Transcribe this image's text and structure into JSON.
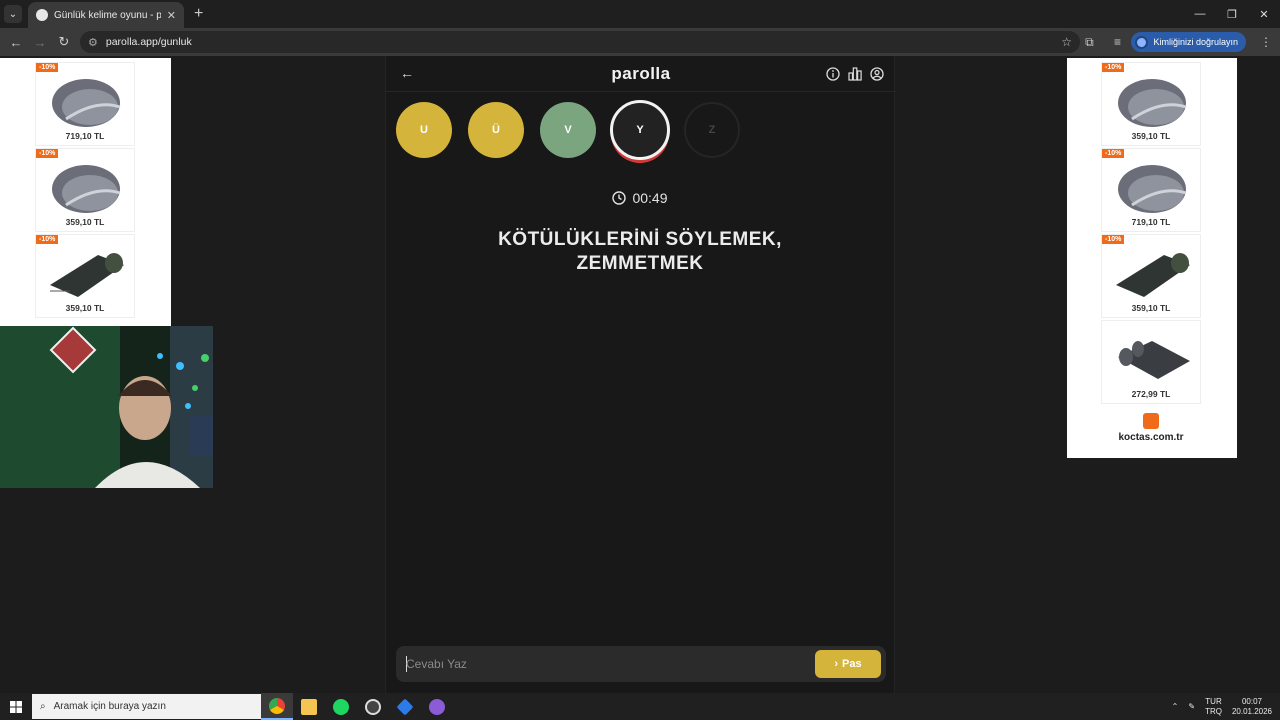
{
  "browser": {
    "tab_title": "Günlük kelime oyunu - parolla",
    "url": "parolla.app/gunluk",
    "profile_label": "Kimliğinizi doğrulayın"
  },
  "ads": {
    "left": [
      {
        "badge": "-10%",
        "price": "719,10 TL",
        "kind": "carpet"
      },
      {
        "badge": "-10%",
        "price": "359,10 TL",
        "kind": "carpet"
      },
      {
        "badge": "-10%",
        "price": "359,10 TL",
        "kind": "roll"
      }
    ],
    "right": [
      {
        "badge": "-10%",
        "price": "359,10 TL",
        "kind": "carpet"
      },
      {
        "badge": "-10%",
        "price": "719,10 TL",
        "kind": "carpet"
      },
      {
        "badge": "-10%",
        "price": "359,10 TL",
        "kind": "roll"
      },
      {
        "badge": "",
        "price": "272,99 TL",
        "kind": "rolls"
      }
    ],
    "brand": "koctas.com.tr"
  },
  "game": {
    "logo": "parolla",
    "letters": [
      {
        "char": "U",
        "state": "yellow"
      },
      {
        "char": "Ü",
        "state": "yellow"
      },
      {
        "char": "V",
        "state": "green"
      },
      {
        "char": "Y",
        "state": "current"
      },
      {
        "char": "Z",
        "state": "pending"
      }
    ],
    "timer": "00:49",
    "clue_line1": "KÖTÜLÜKLERİNİ SÖYLEMEK,",
    "clue_line2": "ZEMMETMEK",
    "input_placeholder": "Cevabı Yaz",
    "pass_label": "Pas"
  },
  "taskbar": {
    "search_placeholder": "Aramak için buraya yazın",
    "lang_top": "TUR",
    "lang_bottom": "TRQ",
    "time": "00:07",
    "date": "20.01.2026"
  },
  "colors": {
    "yellow": "#d4b43a",
    "green": "#7aa57f",
    "accent_red": "#d03a3a",
    "ad_badge": "#ef6b1a"
  }
}
